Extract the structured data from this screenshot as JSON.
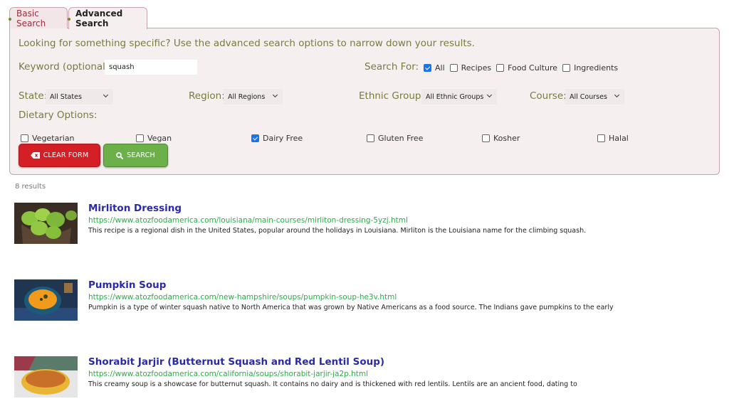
{
  "tabs": [
    {
      "label": "Basic Search",
      "active": false
    },
    {
      "label": "Advanced Search",
      "active": true
    }
  ],
  "panel": {
    "intro": "Looking for something specific? Use the advanced search options to narrow down your results.",
    "keyword": {
      "label": "Keyword (optional):",
      "value": "squash"
    },
    "search_for": {
      "label": "Search For:",
      "options": [
        {
          "label": "All",
          "checked": true
        },
        {
          "label": "Recipes",
          "checked": false
        },
        {
          "label": "Food Culture",
          "checked": false
        },
        {
          "label": "Ingredients",
          "checked": false
        }
      ]
    },
    "filters": {
      "state": {
        "label": "State:",
        "selected": "All States"
      },
      "region": {
        "label": "Region:",
        "selected": "All Regions"
      },
      "ethnic_group": {
        "label": "Ethnic Group:",
        "selected": "All Ethnic Groups"
      },
      "course": {
        "label": "Course:",
        "selected": "All Courses"
      }
    },
    "dietary": {
      "label": "Dietary Options:",
      "options": [
        {
          "label": "Vegetarian",
          "checked": false
        },
        {
          "label": "Vegan",
          "checked": false
        },
        {
          "label": "Dairy Free",
          "checked": true
        },
        {
          "label": "Gluten Free",
          "checked": false
        },
        {
          "label": "Kosher",
          "checked": false
        },
        {
          "label": "Halal",
          "checked": false
        }
      ]
    },
    "buttons": {
      "clear": "CLEAR FORM",
      "search": "SEARCH"
    }
  },
  "results": {
    "count_text": "8 results",
    "items": [
      {
        "title": "Mirliton Dressing",
        "url": "https://www.atozfoodamerica.com/louisiana/main-courses/mirliton-dressing-5yzj.html",
        "description": "This recipe is a regional dish in the United States, popular around the holidays in Louisiana. Mirliton is the Louisiana name for the climbing squash.",
        "thumbnail": "green-mirlitons-in-basket"
      },
      {
        "title": "Pumpkin Soup",
        "url": "https://www.atozfoodamerica.com/new-hampshire/soups/pumpkin-soup-he3v.html",
        "description": "Pumpkin is a type of winter squash native to North America that was grown by Native Americans as a food source. The Indians gave pumpkins to the early",
        "thumbnail": "pumpkin-soup-bowl"
      },
      {
        "title": "Shorabit Jarjir (Butternut Squash and Red Lentil Soup)",
        "url": "https://www.atozfoodamerica.com/california/soups/shorabit-jarjir-ja2p.html",
        "description": "This creamy soup is a showcase for butternut squash. It contains no dairy and is thickened with red lentils. Lentils are an ancient food, dating to",
        "thumbnail": "orange-soup-yellow-bowl"
      }
    ]
  },
  "colors": {
    "panel_bg": "#f6eff0",
    "panel_border": "#c9a3ad",
    "label": "#7a7a3f",
    "clear_button": "#d41f27",
    "search_button": "#6cb04a",
    "result_title": "#2a2aa8",
    "result_url": "#2eaa4a",
    "checkbox_checked": "#1a73e8"
  }
}
